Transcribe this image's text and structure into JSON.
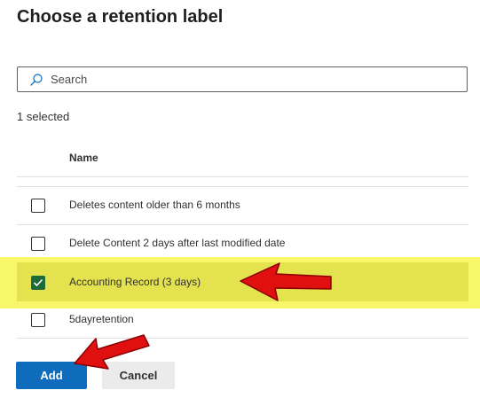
{
  "dialog": {
    "title": "Choose a retention label"
  },
  "search": {
    "placeholder": "Search",
    "icon": "search-icon"
  },
  "selection": {
    "count_text": "1 selected"
  },
  "table": {
    "column_header": "Name",
    "rows": [
      {
        "label": "Deletes content older than 6 months",
        "checked": false
      },
      {
        "label": "Delete Content 2 days after last modified date",
        "checked": false
      },
      {
        "label": "Accounting Record (3 days)",
        "checked": true
      },
      {
        "label": "5dayretention",
        "checked": false
      }
    ]
  },
  "buttons": {
    "add_label": "Add",
    "cancel_label": "Cancel"
  },
  "colors": {
    "primary": "#0f6cbd",
    "checked": "#1e6b3a",
    "highlight": "#f7f769",
    "annotation_arrow": "#e01010"
  }
}
